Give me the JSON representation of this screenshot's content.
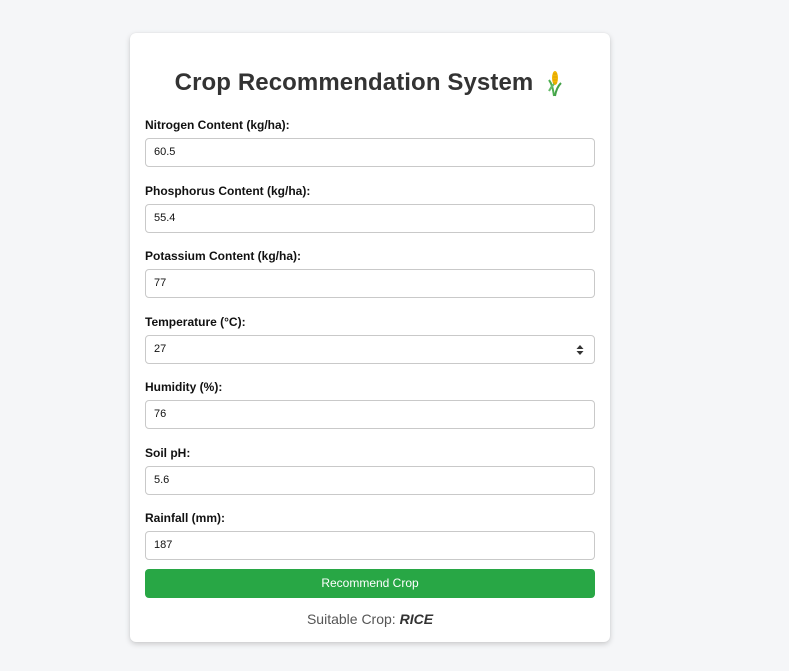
{
  "page": {
    "title": "Crop Recommendation System",
    "title_icon": "corn-crop-icon"
  },
  "form": {
    "fields": [
      {
        "label": "Nitrogen Content (kg/ha):",
        "value": "60.5"
      },
      {
        "label": "Phosphorus Content (kg/ha):",
        "value": "55.4"
      },
      {
        "label": "Potassium Content (kg/ha):",
        "value": "77"
      },
      {
        "label": "Temperature (°C):",
        "value": "27"
      },
      {
        "label": "Humidity (%):",
        "value": "76"
      },
      {
        "label": "Soil pH:",
        "value": "5.6"
      },
      {
        "label": "Rainfall (mm):",
        "value": "187"
      }
    ],
    "submit_label": "Recommend Crop"
  },
  "result": {
    "prefix": "Suitable Crop:",
    "crop": "RICE"
  },
  "colors": {
    "button": "#28a745",
    "background": "#f5f6f8",
    "card": "#ffffff"
  }
}
